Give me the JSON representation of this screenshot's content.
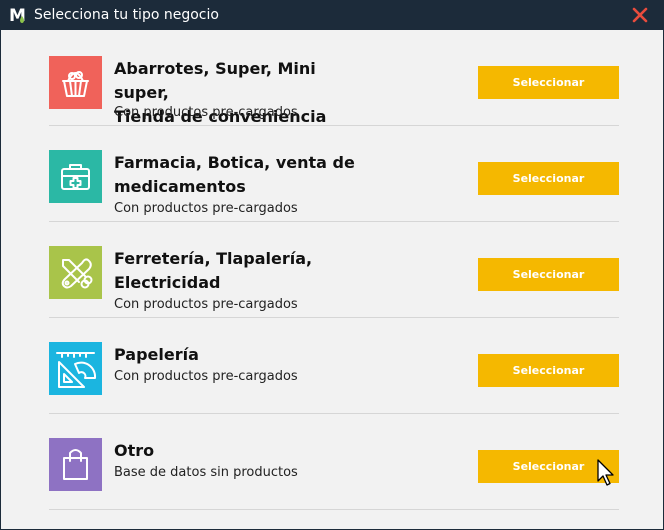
{
  "window": {
    "title": "Selecciona tu tipo negocio",
    "logo_letter": "M",
    "colors": {
      "titlebar": "#1c2b3a",
      "close": "#e84c3d",
      "button": "#f5b800",
      "background": "#f2f2f2"
    }
  },
  "categories": [
    {
      "title_line1": "Abarrotes, Super, Mini super,",
      "title_line2": "Tienda de conveniencia",
      "subtitle": "Con productos pre-cargados",
      "button_label": "Seleccionar",
      "icon": "grocery-basket-icon",
      "color": "#f0625a"
    },
    {
      "title_line1": "Farmacia, Botica, venta de",
      "title_line2": "medicamentos",
      "subtitle": "Con productos pre-cargados",
      "button_label": "Seleccionar",
      "icon": "first-aid-kit-icon",
      "color": "#2bb8a5"
    },
    {
      "title_line1": "Ferretería, Tlapalería,",
      "title_line2": "Electricidad",
      "subtitle": "Con productos pre-cargados",
      "button_label": "Seleccionar",
      "icon": "wrench-pliers-icon",
      "color": "#a9c44a"
    },
    {
      "title_line1": "Papelería",
      "title_line2": "",
      "subtitle": "Con productos pre-cargados",
      "button_label": "Seleccionar",
      "icon": "ruler-protractor-icon",
      "color": "#1bb5e0"
    },
    {
      "title_line1": "Otro",
      "title_line2": "",
      "subtitle": "Base de datos sin productos",
      "button_label": "Seleccionar",
      "icon": "shopping-bag-icon",
      "color": "#8e72c3"
    }
  ]
}
